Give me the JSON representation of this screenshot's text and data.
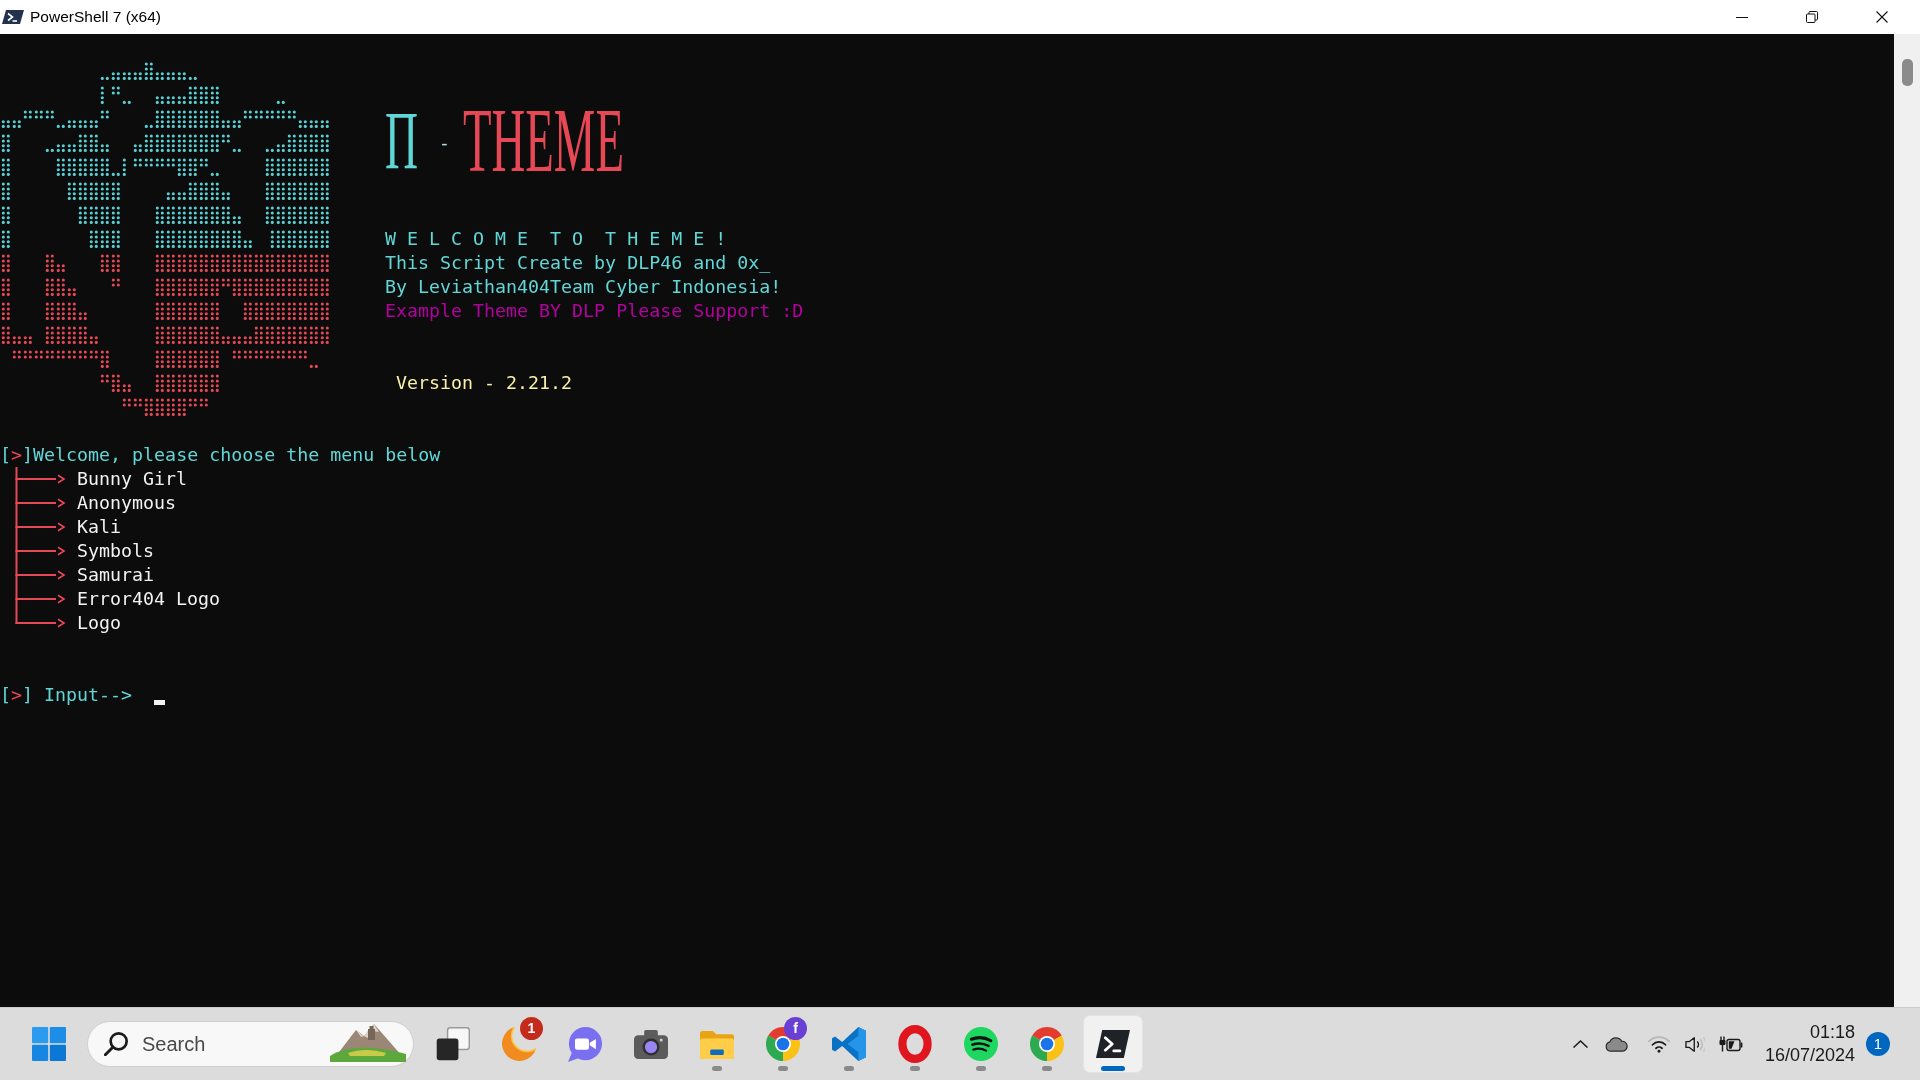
{
  "window": {
    "title": "PowerShell 7 (x64)"
  },
  "banner": {
    "logo_title": {
      "letter": "Π",
      "separator": "-",
      "word": "THEME"
    },
    "lines": [
      {
        "text": "W E L C O M E  T O  T H E M E !",
        "color": "#61d6d6"
      },
      {
        "text": "This Script Create by DLP46 and 0x_",
        "color": "#61d6d6"
      },
      {
        "text": "By Leviathan404Team Cyber Indonesia!",
        "color": "#61d6d6"
      },
      {
        "text": "Example Theme BY DLP Please Support :D",
        "color": "#b4009e"
      }
    ],
    "version": "Version - 2.21.2"
  },
  "menu": {
    "marker": "[>]",
    "heading": "Welcome, please choose the menu below",
    "items": [
      "Bunny Girl",
      "Anonymous",
      "Kali",
      "Symbols",
      "Samurai",
      "Error404 Logo",
      "Logo"
    ]
  },
  "prompt": {
    "marker": "[>]",
    "label": "Input-->"
  },
  "taskbar": {
    "search": {
      "placeholder": "Search"
    },
    "apps": [
      {
        "kind": "task-view",
        "running": false,
        "selected": false
      },
      {
        "kind": "crescent",
        "running": false,
        "selected": false,
        "badge": {
          "text": "1",
          "color": "#c42b1c"
        }
      },
      {
        "kind": "video-chat",
        "running": false,
        "selected": false
      },
      {
        "kind": "camera",
        "running": false,
        "selected": false
      },
      {
        "kind": "folder",
        "running": true,
        "selected": false
      },
      {
        "kind": "browser",
        "running": true,
        "selected": false,
        "badge": {
          "text": "f",
          "color": "#6a3fd4"
        }
      },
      {
        "kind": "code-editor",
        "running": true,
        "selected": false
      },
      {
        "kind": "ring-logo",
        "running": true,
        "selected": false
      },
      {
        "kind": "music",
        "running": true,
        "selected": false
      },
      {
        "kind": "browser",
        "running": true,
        "selected": false
      },
      {
        "kind": "terminal",
        "running": true,
        "selected": true
      }
    ],
    "clock": {
      "time": "01:18",
      "date": "16/07/2024"
    },
    "notifications": "1"
  }
}
